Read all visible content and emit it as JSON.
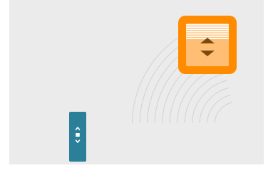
{
  "scene": {
    "arc_count": 12
  },
  "source_widget": {
    "icon": "scroll-up-down-icon",
    "color": "#2b7f98",
    "glyph_color": "#ffffff"
  },
  "target_widget": {
    "icon": "scroll-page-up-down-icon",
    "frame_color": "#ff8c00",
    "fill_color": "#ffbe73",
    "stripe_color": "#ffffff",
    "arrow_color": "#7a4a10"
  },
  "colors": {
    "background": "#ffffff",
    "panel": "#ebebeb",
    "arc_line": "#d2d2d2"
  }
}
